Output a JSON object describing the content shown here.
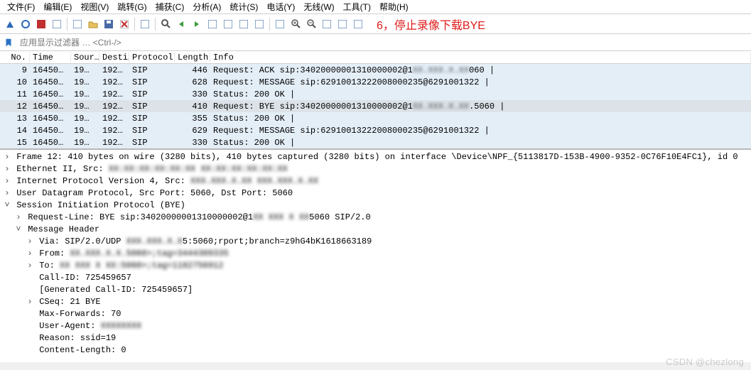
{
  "menus": [
    "文件(F)",
    "编辑(E)",
    "视图(V)",
    "跳转(G)",
    "捕获(C)",
    "分析(A)",
    "统计(S)",
    "电话(Y)",
    "无线(W)",
    "工具(T)",
    "帮助(H)"
  ],
  "annotation": "6，停止录像下载BYE",
  "filter": {
    "placeholder": "应用显示过滤器 … <Ctrl-/>"
  },
  "columns": {
    "no": "No.",
    "time": "Time",
    "src": "Sour…",
    "dst": "Desti…",
    "proto": "Protocol",
    "len": "Length",
    "info": "Info"
  },
  "packets": [
    {
      "no": "9",
      "time": "16450…",
      "src": "19…",
      "dst": "192…",
      "proto": "SIP",
      "len": "446",
      "info_a": "Request: ACK sip:34020000001310000002@1",
      "info_blur": "XX.XXX.X.XX",
      "info_b": "060 |"
    },
    {
      "no": "10",
      "time": "16450…",
      "src": "19…",
      "dst": "192…",
      "proto": "SIP",
      "len": "628",
      "info_a": "Request: MESSAGE sip:62910013222008000235@6291001322 |",
      "info_blur": "",
      "info_b": ""
    },
    {
      "no": "11",
      "time": "16450…",
      "src": "19…",
      "dst": "192…",
      "proto": "SIP",
      "len": "330",
      "info_a": "Status: 200 OK |",
      "info_blur": "",
      "info_b": ""
    },
    {
      "no": "12",
      "time": "16450…",
      "src": "19…",
      "dst": "192…",
      "proto": "SIP",
      "len": "410",
      "info_a": "Request: BYE sip:34020000001310000002@1",
      "info_blur": "XX.XXX.X.XX",
      "info_b": ".5060 |",
      "selected": true
    },
    {
      "no": "13",
      "time": "16450…",
      "src": "19…",
      "dst": "192…",
      "proto": "SIP",
      "len": "355",
      "info_a": "Status: 200 OK |",
      "info_blur": "",
      "info_b": ""
    },
    {
      "no": "14",
      "time": "16450…",
      "src": "19…",
      "dst": "192…",
      "proto": "SIP",
      "len": "629",
      "info_a": "Request: MESSAGE sip:62910013222008000235@6291001322 |",
      "info_blur": "",
      "info_b": ""
    },
    {
      "no": "15",
      "time": "16450…",
      "src": "19…",
      "dst": "192…",
      "proto": "SIP",
      "len": "330",
      "info_a": "Status: 200 OK |",
      "info_blur": "",
      "info_b": ""
    }
  ],
  "details": [
    {
      "ind": 0,
      "tw": ">",
      "a": "Frame 12: 410 bytes on wire (3280 bits), 410 bytes captured (3280 bits) on interface \\Device\\NPF_{5113817D-153B-4900-9352-0C76F10E4FC1}, id 0"
    },
    {
      "ind": 0,
      "tw": ">",
      "a": "Ethernet II, Src: ",
      "blur": "XX:XX:XX:XX:XX:XX  XX:XX:XX:XX:XX:XX"
    },
    {
      "ind": 0,
      "tw": ">",
      "a": "Internet Protocol Version 4, Src: ",
      "blur": "XXX.XXX.X.XX    XXX.XXX.X.XX"
    },
    {
      "ind": 0,
      "tw": ">",
      "a": "User Datagram Protocol, Src Port: 5060, Dst Port: 5060"
    },
    {
      "ind": 0,
      "tw": "v",
      "a": "Session Initiation Protocol (BYE)"
    },
    {
      "ind": 1,
      "tw": ">",
      "a": "Request-Line: BYE sip:34020000001310000002@1",
      "blur": "XX XXX X XX",
      "b": "5060 SIP/2.0"
    },
    {
      "ind": 1,
      "tw": "v",
      "a": "Message Header"
    },
    {
      "ind": 2,
      "tw": ">",
      "a": "Via: SIP/2.0/UDP ",
      "blur": "XXX.XXX.X.X",
      "b": "5:5060;rport;branch=z9hG4bK1618663189"
    },
    {
      "ind": 2,
      "tw": ">",
      "a": "From: <sip:62910013222008000235@1",
      "blur": "XX.XXX.X.X",
      "b": ".5060>;tag=3444309335"
    },
    {
      "ind": 2,
      "tw": ">",
      "a": "To: <sip:34020000001310000002@1",
      "blur": "XX  XXX  X  XX",
      "b": ":5060>;tag=1182756912"
    },
    {
      "ind": 2,
      "tw": "",
      "a": "Call-ID: 725459657"
    },
    {
      "ind": 2,
      "tw": "",
      "a": "[Generated Call-ID: 725459657]"
    },
    {
      "ind": 2,
      "tw": ">",
      "a": "CSeq: 21 BYE"
    },
    {
      "ind": 2,
      "tw": "",
      "a": "Max-Forwards: 70"
    },
    {
      "ind": 2,
      "tw": "",
      "a": "User-Agent: ",
      "blur": "XXXXXXXX"
    },
    {
      "ind": 2,
      "tw": "",
      "a": "Reason: ssid=19"
    },
    {
      "ind": 2,
      "tw": "",
      "a": "Content-Length: 0"
    }
  ],
  "toolbar_icons": [
    "shark-fin-icon",
    "circle-icon",
    "stop-icon",
    "restart-icon",
    "gear-icon",
    "folder-open-icon",
    "save-icon",
    "close-file-icon",
    "reload-icon",
    "find-icon",
    "arrow-left-icon",
    "arrow-right-icon",
    "jump-icon",
    "goto-first-icon",
    "goto-last-icon",
    "autoscroll-icon",
    "colorize-icon",
    "zoom-in-icon",
    "zoom-out-icon",
    "zoom-actual-icon",
    "zoom-fit-icon",
    "resize-cols-icon"
  ],
  "watermark": "CSDN @chezlong"
}
